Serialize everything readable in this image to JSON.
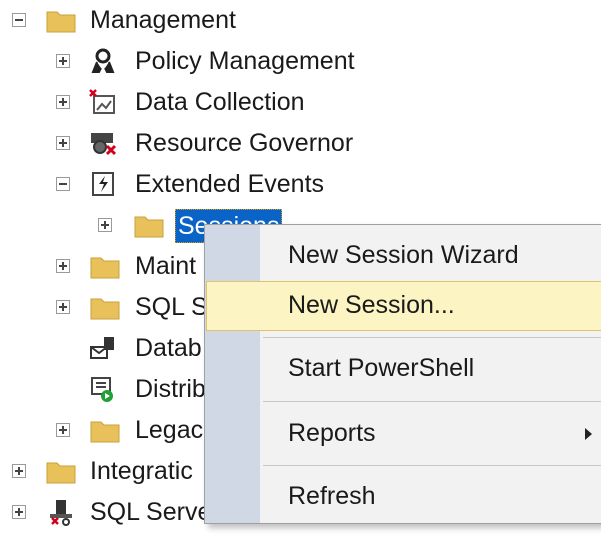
{
  "tree": {
    "management": "Management",
    "policy_management": "Policy Management",
    "data_collection": "Data Collection",
    "resource_governor": "Resource Governor",
    "extended_events": "Extended Events",
    "sessions": "Sessions",
    "maint": "Maint",
    "sql_s": "SQL S",
    "datab": "Datab",
    "distrib": "Distrib",
    "legac": "Legac",
    "integratic": "Integratic",
    "sql_serve": "SQL Serve"
  },
  "context_menu": {
    "items": [
      {
        "label": "New Session Wizard"
      },
      {
        "label": "New Session..."
      },
      {
        "label": "Start PowerShell"
      },
      {
        "label": "Reports"
      },
      {
        "label": "Refresh"
      }
    ]
  },
  "colors": {
    "folder": "#e8c15a",
    "selection": "#0a64c8",
    "highlight": "#fdf4c4",
    "gutter": "#cfd8e4"
  }
}
